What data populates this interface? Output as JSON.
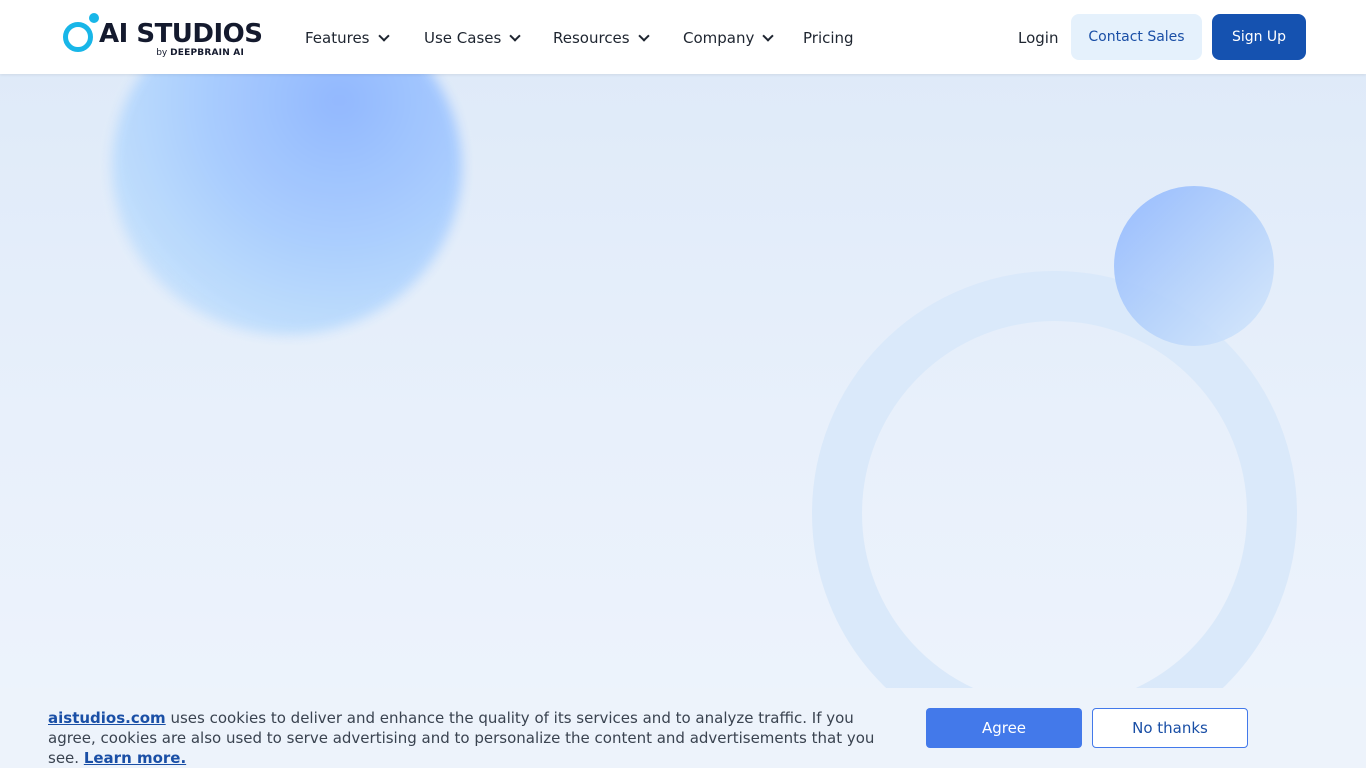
{
  "header": {
    "logo": {
      "wordmark": "AI STUDIOS",
      "by": "by",
      "brand": "DEEPBRAIN AI"
    },
    "nav": [
      {
        "label": "Features",
        "has_dropdown": true
      },
      {
        "label": "Use Cases",
        "has_dropdown": true
      },
      {
        "label": "Resources",
        "has_dropdown": true
      },
      {
        "label": "Company",
        "has_dropdown": true
      },
      {
        "label": "Pricing",
        "has_dropdown": false
      }
    ],
    "login_label": "Login",
    "contact_label": "Contact Sales",
    "signup_label": "Sign Up"
  },
  "cookie": {
    "site_link": "aistudios.com",
    "message": " uses cookies to deliver and enhance the quality of its services and to analyze traffic. If you agree, cookies are also used to serve advertising and to personalize the content and advertisements that you see. ",
    "learn_more": "Learn more.",
    "agree_label": "Agree",
    "decline_label": "No thanks"
  },
  "colors": {
    "primary": "#1552b0",
    "accent": "#4379ea",
    "logo_cyan": "#18b6e8",
    "background": "#e3edf9"
  },
  "icons": {
    "dropdown": "chevron-down-icon",
    "logo": "logo-ring-icon"
  }
}
